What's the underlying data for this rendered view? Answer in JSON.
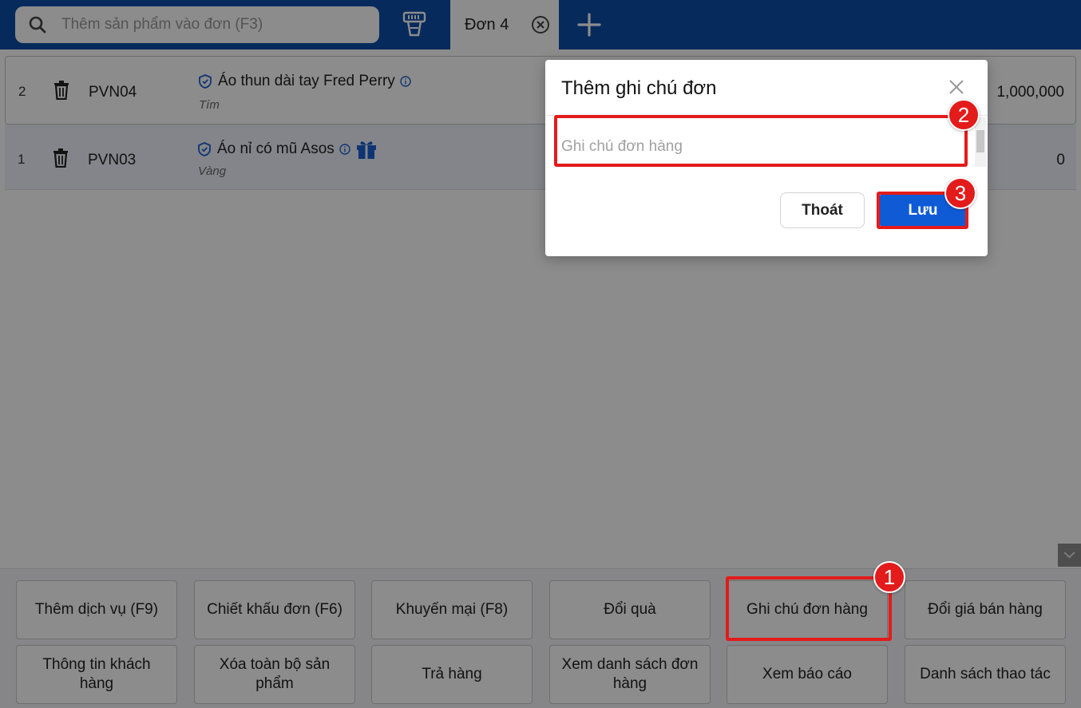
{
  "search": {
    "placeholder": "Thêm sản phẩm vào đơn (F3)"
  },
  "tab": {
    "label": "Đơn 4"
  },
  "rows": [
    {
      "index": "2",
      "sku": "PVN04",
      "name": "Áo thun dài tay Fred Perry",
      "variant": "Tím",
      "total": "1,000,000",
      "gift": false
    },
    {
      "index": "1",
      "sku": "PVN03",
      "name": "Áo nỉ có mũ Asos",
      "variant": "Vàng",
      "total": "0",
      "gift": true
    }
  ],
  "actions": [
    [
      "Thêm dịch vụ (F9)",
      "Chiết khấu đơn (F6)",
      "Khuyến mại (F8)",
      "Đổi quà",
      "Ghi chú đơn hàng",
      "Đổi giá bán hàng"
    ],
    [
      "Thông tin khách hàng",
      "Xóa toàn bộ sản phẩm",
      "Trả hàng",
      "Xem danh sách đơn hàng",
      "Xem báo cáo",
      "Danh sách thao tác"
    ]
  ],
  "modal": {
    "title": "Thêm ghi chú đơn",
    "placeholder": "Ghi chú đơn hàng",
    "cancel": "Thoát",
    "save": "Lưu"
  },
  "annotations": {
    "step1": "1",
    "step2": "2",
    "step3": "3",
    "color": "#e31b1b"
  },
  "colors": {
    "topbar": "#0b4da8",
    "primary": "#0f5bd6",
    "shield": "#1a5fd0"
  }
}
